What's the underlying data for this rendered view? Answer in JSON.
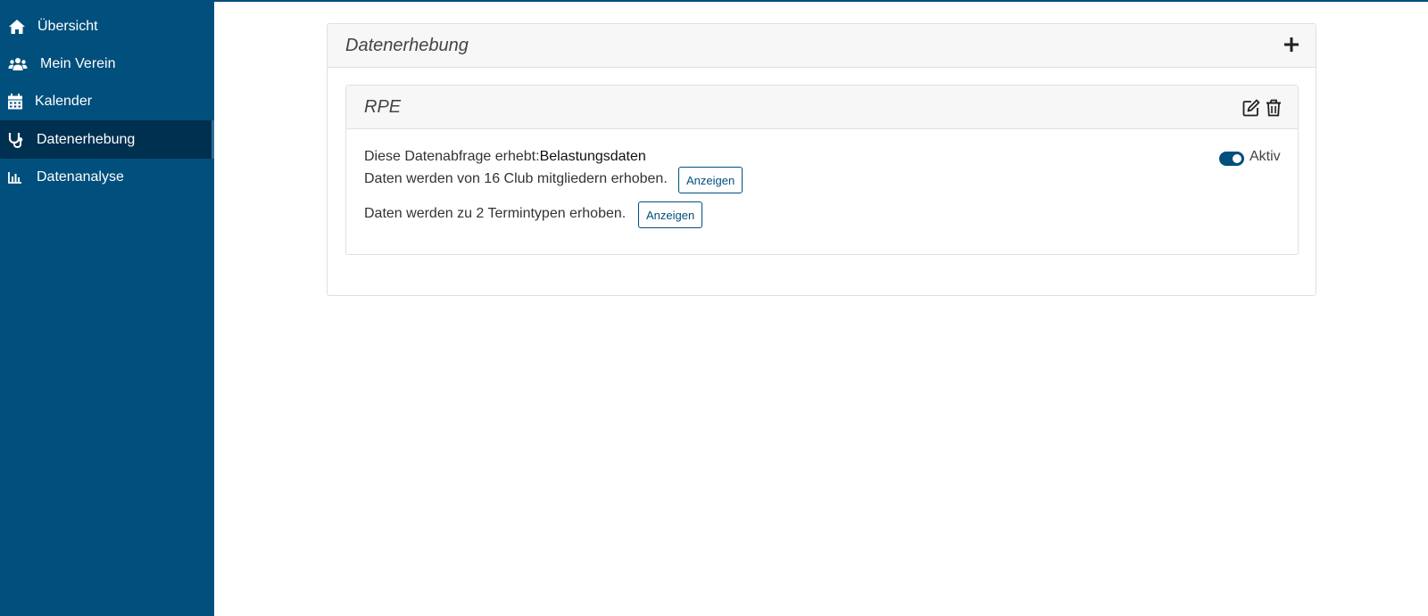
{
  "sidebar": {
    "items": [
      {
        "label": "Übersicht",
        "icon": "home-icon"
      },
      {
        "label": "Mein Verein",
        "icon": "users-icon"
      },
      {
        "label": "Kalender",
        "icon": "calendar-icon"
      },
      {
        "label": "Datenerhebung",
        "icon": "stethoscope-icon",
        "active": true
      },
      {
        "label": "Datenanalyse",
        "icon": "bar-chart-icon"
      }
    ]
  },
  "main": {
    "card_title": "Datenerhebung",
    "add_icon": "plus-icon",
    "survey": {
      "title": "RPE",
      "edit_icon": "edit-icon",
      "delete_icon": "trash-icon",
      "collects_prefix": "Diese Datenabfrage erhebt:",
      "collects_value": "Belastungsdaten",
      "members_text": "Daten werden von 16 Club mitgliedern erhoben.",
      "members_button": "Anzeigen",
      "types_text": "Daten werden zu 2 Termintypen erhoben.",
      "types_button": "Anzeigen",
      "status_label": "Aktiv",
      "status_active": true
    }
  },
  "colors": {
    "primary": "#004f7c",
    "active_nav": "#003050",
    "card_header": "#f7f7f7"
  }
}
